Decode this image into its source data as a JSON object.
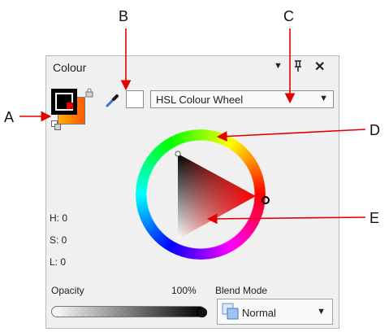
{
  "callouts": {
    "a": "A",
    "b": "B",
    "c": "C",
    "d": "D",
    "e": "E"
  },
  "panel": {
    "title": "Colour",
    "menu_icon": "dropdown-triangle-icon",
    "pin_icon": "pin-icon",
    "close_icon": "close-icon",
    "mode_select": {
      "value": "HSL Colour Wheel"
    },
    "hsl": {
      "h": "H: 0",
      "s": "S: 0",
      "l": "L: 0"
    },
    "opacity": {
      "label": "Opacity",
      "value": "100%",
      "fraction": 1.0
    },
    "blend_mode": {
      "label": "Blend Mode",
      "value": "Normal"
    }
  },
  "colors": {
    "callout_arrow": "#e00000",
    "primary_swatch": "#ff0000",
    "secondary_gradient": [
      "#ffb000",
      "#ff6a00"
    ],
    "panel_bg": "#f0f0f0"
  }
}
